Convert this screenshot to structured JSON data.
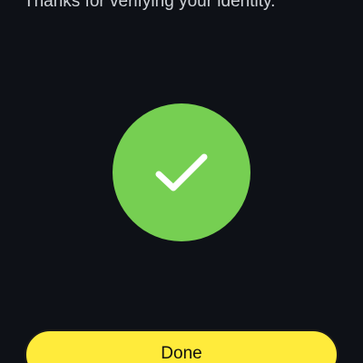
{
  "header": {
    "subtitle": "Thanks for verifying your identity."
  },
  "status": {
    "icon": "checkmark-icon",
    "color": "#76cf52"
  },
  "actions": {
    "done_label": "Done",
    "done_color": "#ffeb3b"
  },
  "theme": {
    "background": "#0e1117"
  }
}
